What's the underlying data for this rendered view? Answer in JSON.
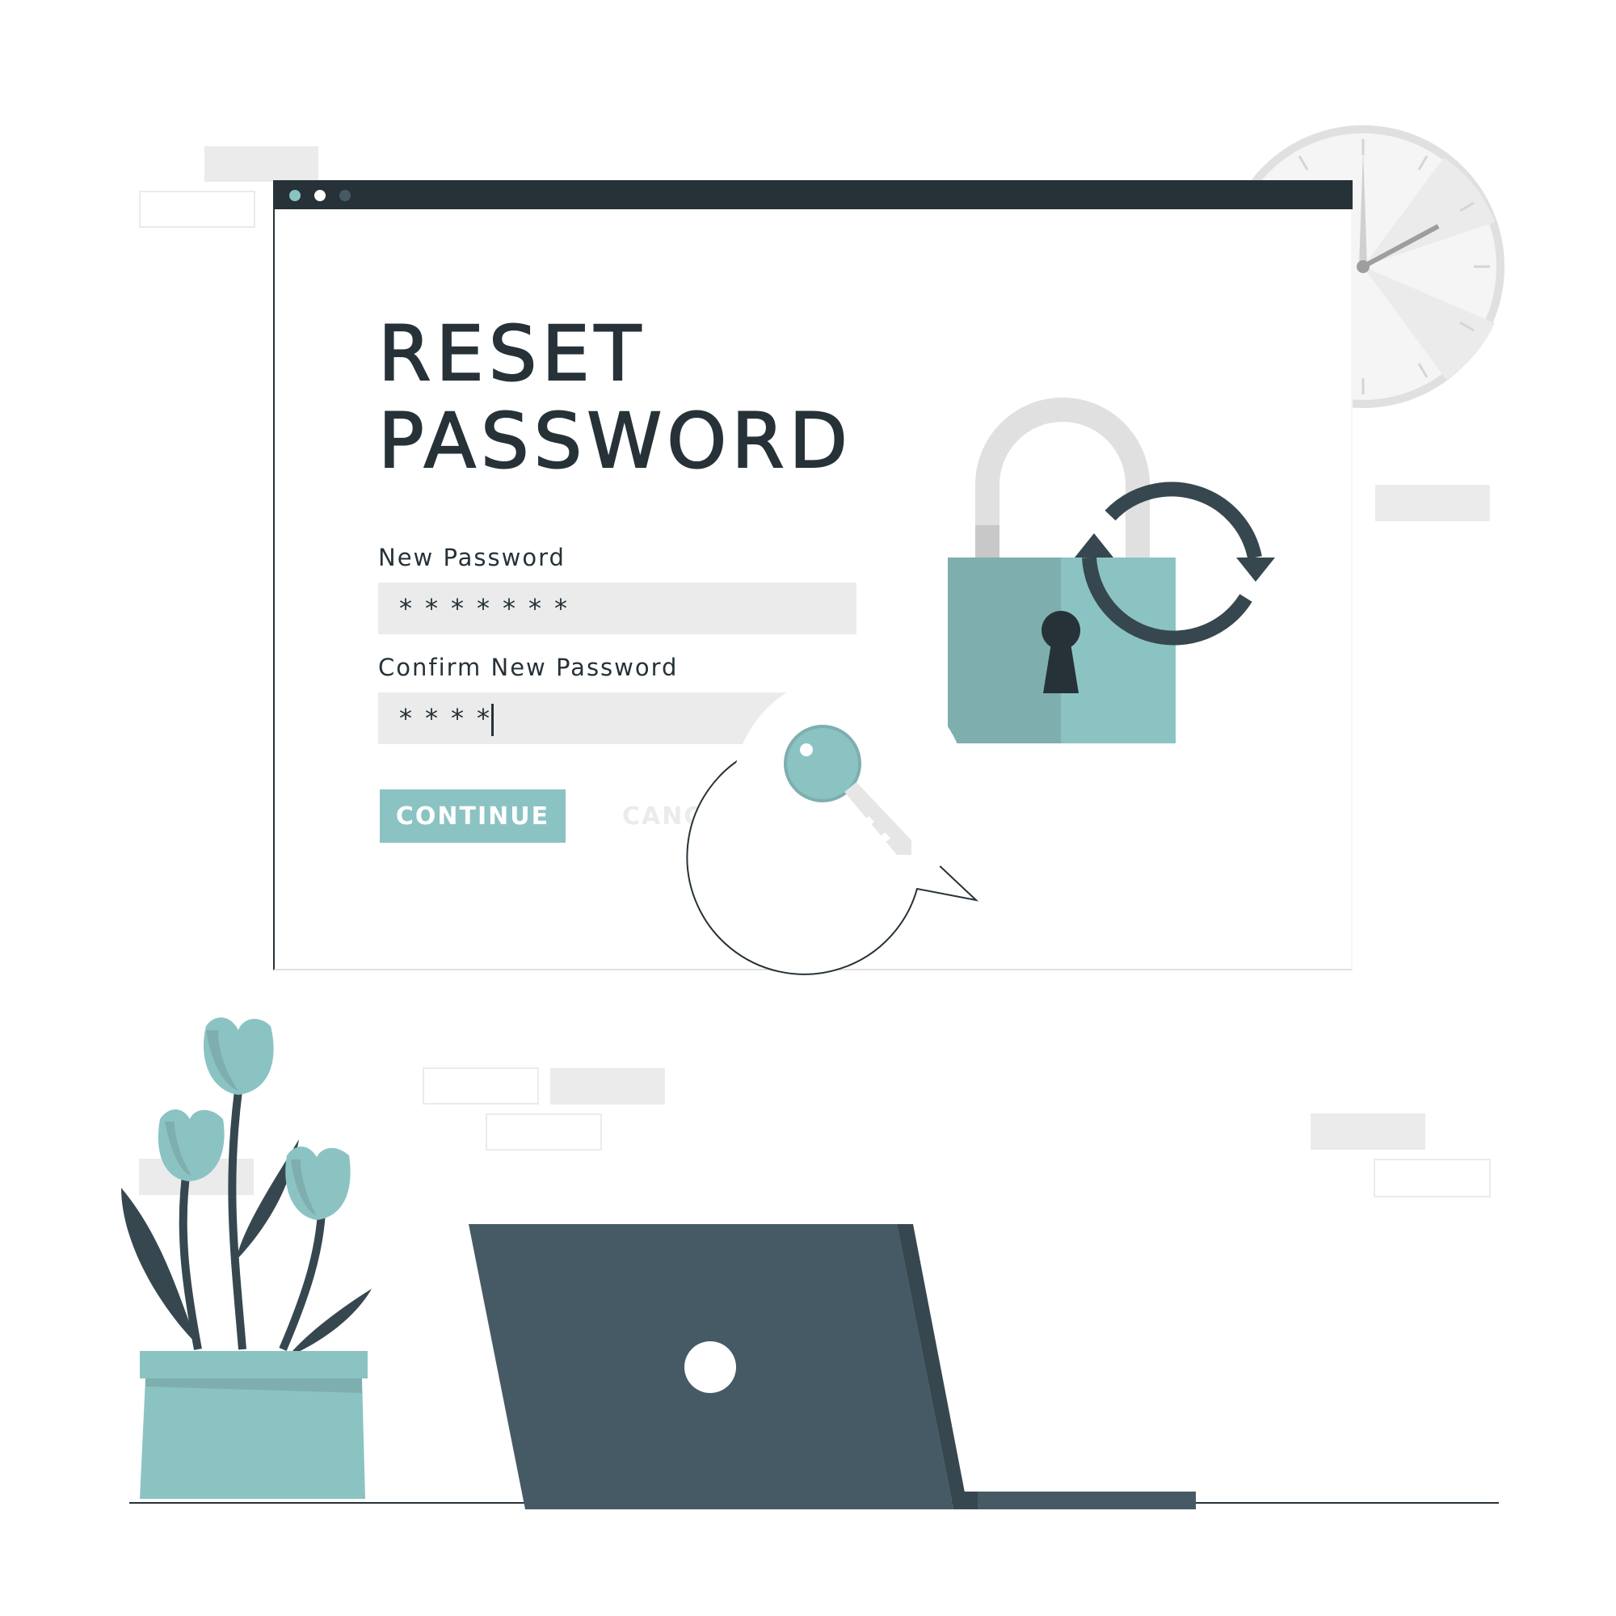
{
  "form": {
    "title_line1": "RESET",
    "title_line2": "PASSWORD",
    "new_password_label": "New Password",
    "new_password_value": "*******",
    "confirm_password_label": "Confirm New Password",
    "confirm_password_value": "****",
    "continue_label": "CONTINUE",
    "cancel_label": "CANCEL"
  },
  "icons": {
    "lock": "padlock-icon",
    "refresh": "refresh-arrows-icon",
    "key": "key-icon",
    "clock": "wall-clock-icon",
    "laptop": "laptop-icon",
    "plant": "potted-tulips-icon"
  },
  "colors": {
    "accent": "#8bc3c3",
    "dark": "#263238",
    "slate": "#455a64",
    "light_gray": "#ebebeb"
  }
}
